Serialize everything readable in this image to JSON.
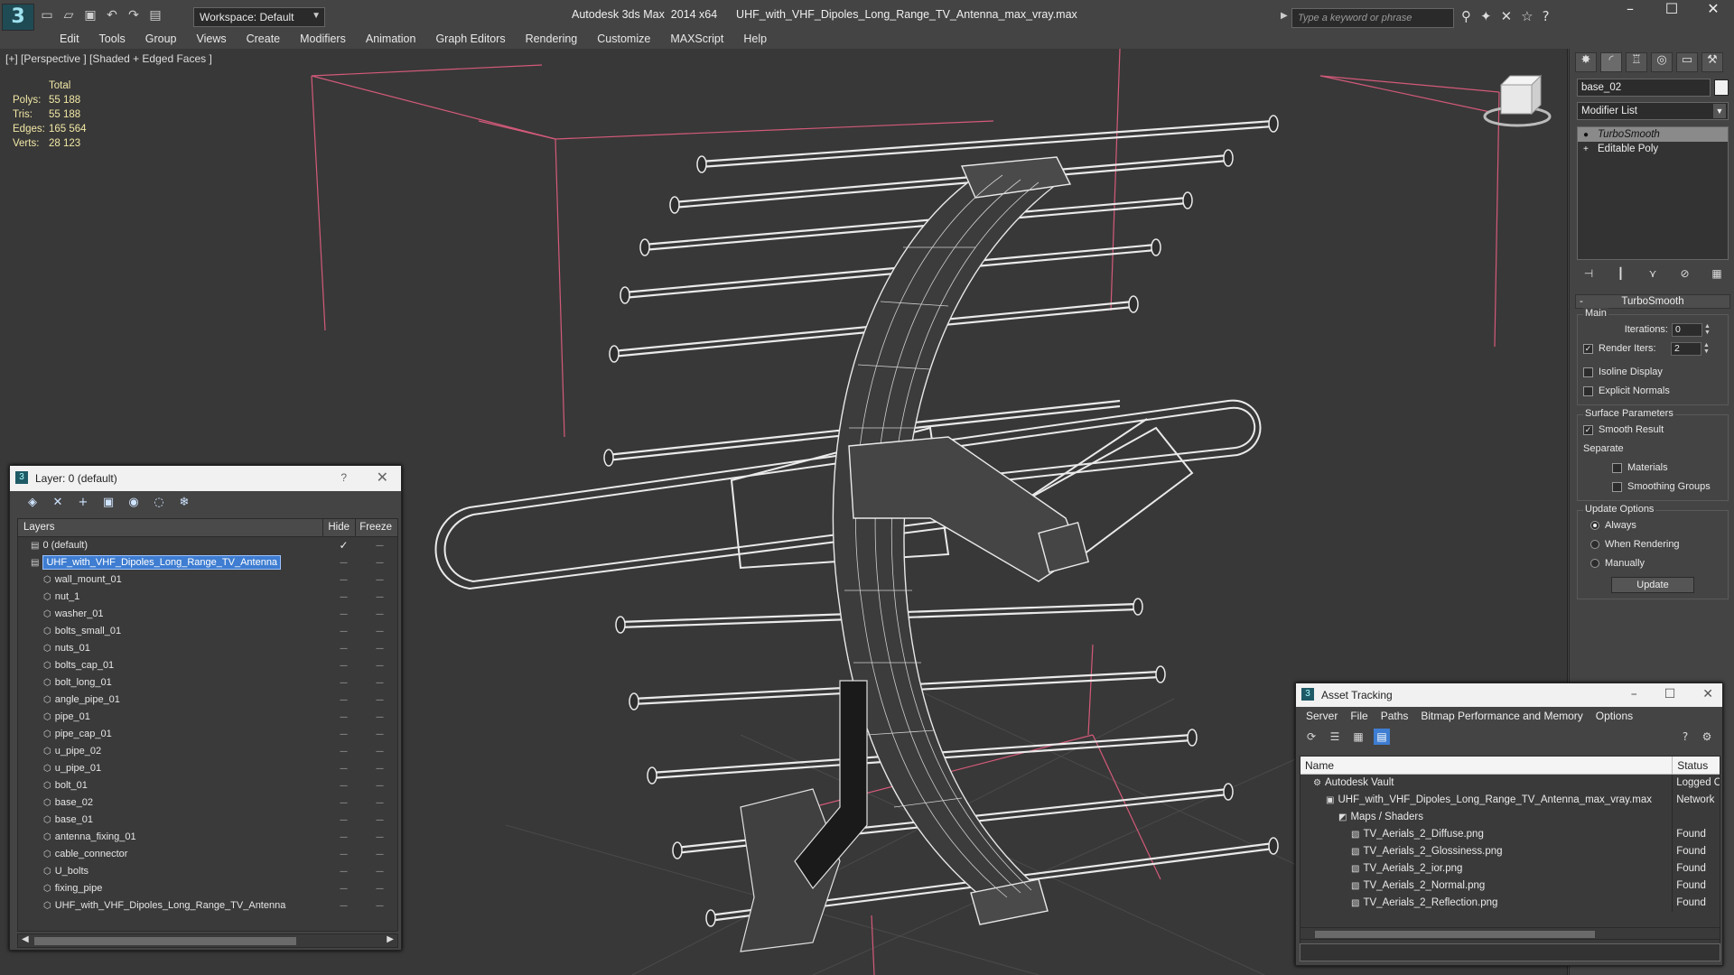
{
  "titlebar": {
    "logo": "3",
    "workspace": "Workspace: Default",
    "title": "Autodesk 3ds Max  2014 x64      UHF_with_VHF_Dipoles_Long_Range_TV_Antenna_max_vray.max",
    "search_placeholder": "Type a keyword or phrase"
  },
  "menu": [
    "Edit",
    "Tools",
    "Group",
    "Views",
    "Create",
    "Modifiers",
    "Animation",
    "Graph Editors",
    "Rendering",
    "Customize",
    "MAXScript",
    "Help"
  ],
  "viewport": {
    "label": "[+] [Perspective ] [Shaded + Edged Faces ]",
    "stats_header": "Total",
    "stats": [
      {
        "k": "Polys:",
        "v": "55 188"
      },
      {
        "k": "Tris:",
        "v": "55 188"
      },
      {
        "k": "Edges:",
        "v": "165 564"
      },
      {
        "k": "Verts:",
        "v": "28 123"
      }
    ]
  },
  "command_panel": {
    "object_name": "base_02",
    "modifier_list": "Modifier List",
    "stack": [
      {
        "label": "TurboSmooth",
        "selected": true
      },
      {
        "label": "Editable Poly",
        "selected": false
      }
    ],
    "rollout_title": "TurboSmooth",
    "main_group": "Main",
    "iterations_label": "Iterations:",
    "iterations_value": "0",
    "render_iters_label": "Render Iters:",
    "render_iters_value": "2",
    "isoline_label": "Isoline Display",
    "explicit_normals_label": "Explicit Normals",
    "surface_group": "Surface Parameters",
    "smooth_result_label": "Smooth Result",
    "separate_label": "Separate",
    "materials_label": "Materials",
    "smoothing_groups_label": "Smoothing Groups",
    "update_group": "Update Options",
    "always_label": "Always",
    "when_rendering_label": "When Rendering",
    "manually_label": "Manually",
    "update_button": "Update"
  },
  "layer_panel": {
    "title": "Layer: 0 (default)",
    "help": "?",
    "col_layers": "Layers",
    "col_hide": "Hide",
    "col_freeze": "Freeze",
    "rows": [
      {
        "name": "0 (default)",
        "level": 0,
        "type": "layer"
      },
      {
        "name": "UHF_with_VHF_Dipoles_Long_Range_TV_Antenna",
        "level": 0,
        "type": "layer",
        "selected": true
      },
      {
        "name": "wall_mount_01",
        "level": 1
      },
      {
        "name": "nut_1",
        "level": 1
      },
      {
        "name": "washer_01",
        "level": 1
      },
      {
        "name": "bolts_small_01",
        "level": 1
      },
      {
        "name": "nuts_01",
        "level": 1
      },
      {
        "name": "bolts_cap_01",
        "level": 1
      },
      {
        "name": "bolt_long_01",
        "level": 1
      },
      {
        "name": "angle_pipe_01",
        "level": 1
      },
      {
        "name": "pipe_01",
        "level": 1
      },
      {
        "name": "pipe_cap_01",
        "level": 1
      },
      {
        "name": "u_pipe_02",
        "level": 1
      },
      {
        "name": "u_pipe_01",
        "level": 1
      },
      {
        "name": "bolt_01",
        "level": 1
      },
      {
        "name": "base_02",
        "level": 1
      },
      {
        "name": "base_01",
        "level": 1
      },
      {
        "name": "antenna_fixing_01",
        "level": 1
      },
      {
        "name": "cable_connector",
        "level": 1
      },
      {
        "name": "U_bolts",
        "level": 1
      },
      {
        "name": "fixing_pipe",
        "level": 1
      },
      {
        "name": "UHF_with_VHF_Dipoles_Long_Range_TV_Antenna",
        "level": 1
      }
    ]
  },
  "asset_panel": {
    "title": "Asset Tracking",
    "menu": [
      "Server",
      "File",
      "Paths",
      "Bitmap Performance and Memory",
      "Options"
    ],
    "col_name": "Name",
    "col_status": "Status",
    "rows": [
      {
        "name": "Autodesk Vault",
        "status": "Logged O",
        "indent": 1
      },
      {
        "name": "UHF_with_VHF_Dipoles_Long_Range_TV_Antenna_max_vray.max",
        "status": "Network",
        "indent": 2
      },
      {
        "name": "Maps / Shaders",
        "status": "",
        "indent": 3
      },
      {
        "name": "TV_Aerials_2_Diffuse.png",
        "status": "Found",
        "indent": 4
      },
      {
        "name": "TV_Aerials_2_Glossiness.png",
        "status": "Found",
        "indent": 4
      },
      {
        "name": "TV_Aerials_2_ior.png",
        "status": "Found",
        "indent": 4
      },
      {
        "name": "TV_Aerials_2_Normal.png",
        "status": "Found",
        "indent": 4
      },
      {
        "name": "TV_Aerials_2_Reflection.png",
        "status": "Found",
        "indent": 4
      }
    ]
  },
  "colors": {
    "accent": "#3e7dd1",
    "viewport_bg": "#383838",
    "wire": "#e0e0e0",
    "gizmo_lines": "#d45a7a",
    "stats_text": "#f2e8a6"
  }
}
